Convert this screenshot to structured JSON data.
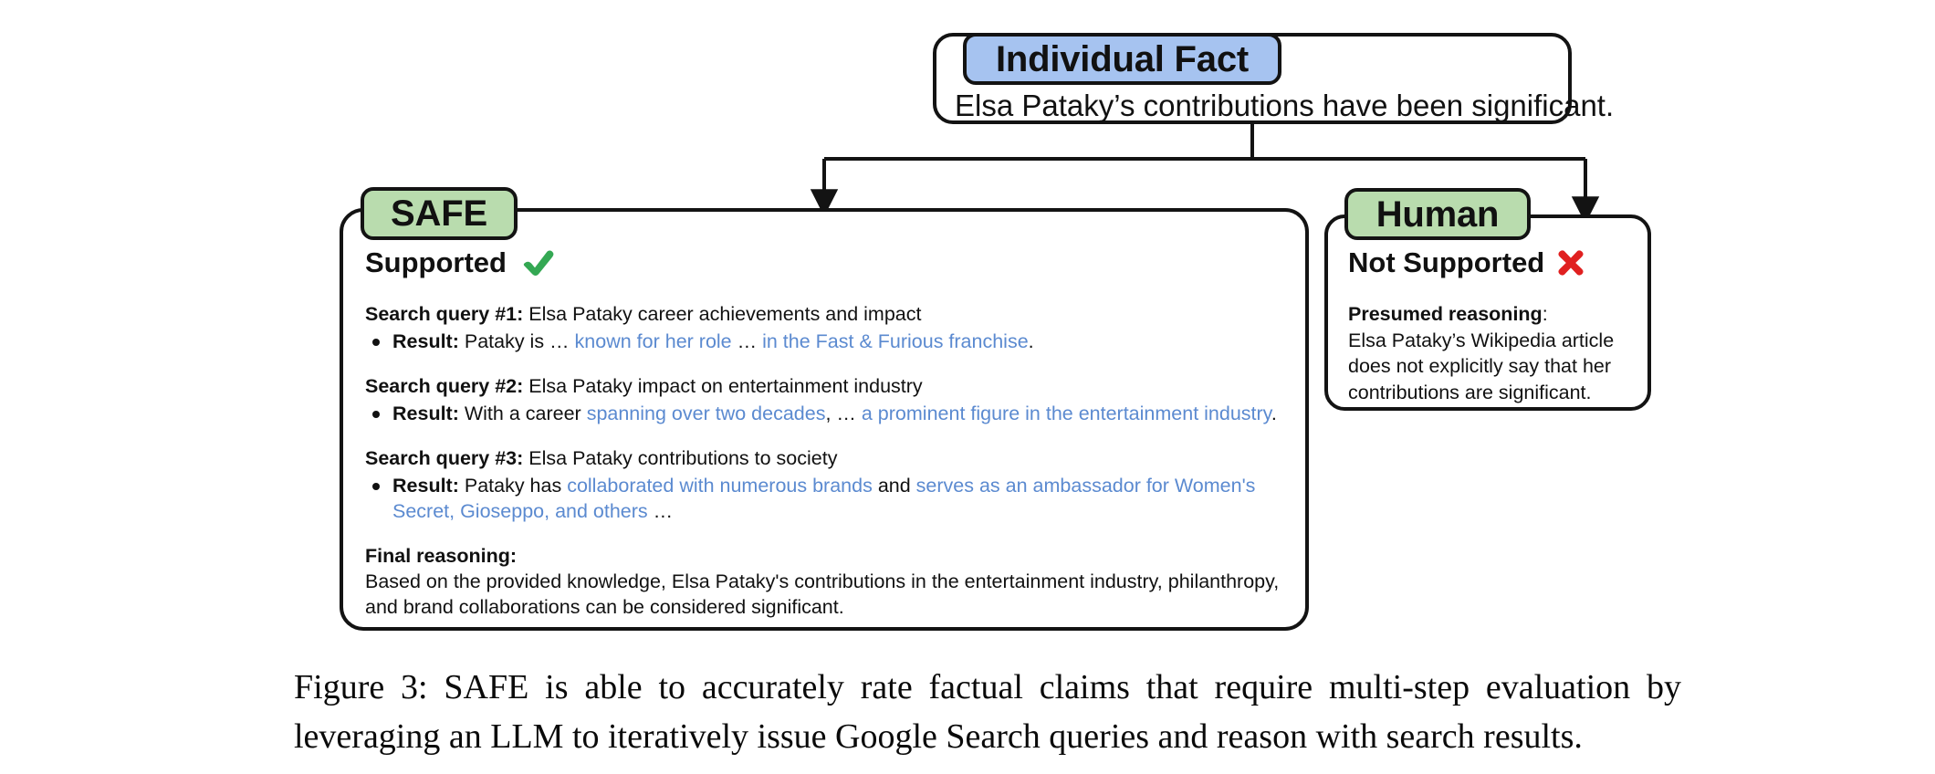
{
  "figure": {
    "caption_prefix": "Figure 3:",
    "caption_line1": "Figure 3:  SAFE is able to accurately rate factual claims that require multi-step evaluation by",
    "caption_line2": "leveraging an LLM to iteratively issue Google Search queries and reason with search results."
  },
  "colors": {
    "badge_blue": "#a6c3f0",
    "badge_green": "#b9dcae",
    "source_text_blue": "#5b8ad0",
    "check_green": "#34a853",
    "cross_red": "#e02020",
    "outline_black": "#131313",
    "card_background": "#ffffff"
  },
  "fact": {
    "badge_label": "Individual Fact",
    "text": "Elsa Pataky’s contributions have been significant."
  },
  "safe": {
    "badge_label": "SAFE",
    "verdict": "Supported",
    "verdict_icon": "check-icon",
    "queries": [
      {
        "query_label": "Search query #1:",
        "query_text": "Elsa Pataky career achievements and impact",
        "result_label": "Result:",
        "result_parts": [
          {
            "text": "Pataky is … ",
            "style": "plain"
          },
          {
            "text": "known for her role",
            "style": "source"
          },
          {
            "text": " … ",
            "style": "plain"
          },
          {
            "text": "in the Fast & Furious franchise",
            "style": "source"
          },
          {
            "text": ".",
            "style": "plain"
          }
        ]
      },
      {
        "query_label": "Search query #2:",
        "query_text": "Elsa Pataky impact on entertainment industry",
        "result_label": "Result:",
        "result_parts": [
          {
            "text": "With a career ",
            "style": "plain"
          },
          {
            "text": "spanning over two decades",
            "style": "source"
          },
          {
            "text": ", … ",
            "style": "plain"
          },
          {
            "text": "a prominent figure in the entertainment industry",
            "style": "source"
          },
          {
            "text": ".",
            "style": "plain"
          }
        ]
      },
      {
        "query_label": "Search query #3:",
        "query_text": "Elsa Pataky contributions to society",
        "result_label": "Result:",
        "result_parts": [
          {
            "text": "Pataky has ",
            "style": "plain"
          },
          {
            "text": "collaborated with numerous brands",
            "style": "source"
          },
          {
            "text": " and ",
            "style": "plain"
          },
          {
            "text": "serves as an ambassador for Women's Secret, Gioseppo, and others",
            "style": "source"
          },
          {
            "text": " …",
            "style": "plain"
          }
        ]
      }
    ],
    "final_label": "Final reasoning:",
    "final_text": "Based on the provided knowledge, Elsa Pataky's contributions in the entertainment industry, philanthropy, and brand collaborations can be considered significant."
  },
  "human": {
    "badge_label": "Human",
    "verdict": "Not Supported",
    "verdict_icon": "cross-icon",
    "reasoning_label": "Presumed reasoning",
    "reasoning_label_suffix": ":",
    "reasoning_text": "Elsa Pataky’s Wikipedia article does not explicitly say that her contributions are significant."
  }
}
